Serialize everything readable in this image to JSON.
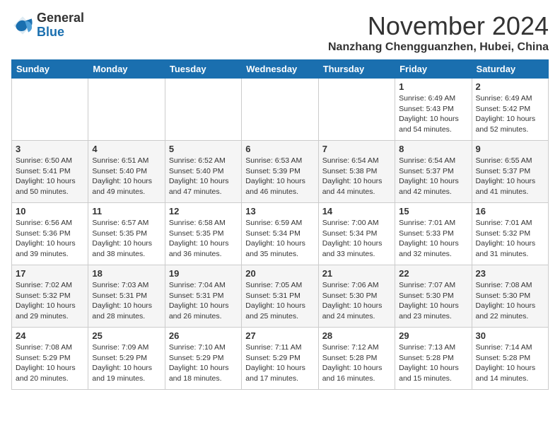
{
  "header": {
    "logo_general": "General",
    "logo_blue": "Blue",
    "title": "November 2024",
    "location": "Nanzhang Chengguanzhen, Hubei, China"
  },
  "weekdays": [
    "Sunday",
    "Monday",
    "Tuesday",
    "Wednesday",
    "Thursday",
    "Friday",
    "Saturday"
  ],
  "weeks": [
    [
      {
        "day": "",
        "info": ""
      },
      {
        "day": "",
        "info": ""
      },
      {
        "day": "",
        "info": ""
      },
      {
        "day": "",
        "info": ""
      },
      {
        "day": "",
        "info": ""
      },
      {
        "day": "1",
        "info": "Sunrise: 6:49 AM\nSunset: 5:43 PM\nDaylight: 10 hours and 54 minutes."
      },
      {
        "day": "2",
        "info": "Sunrise: 6:49 AM\nSunset: 5:42 PM\nDaylight: 10 hours and 52 minutes."
      }
    ],
    [
      {
        "day": "3",
        "info": "Sunrise: 6:50 AM\nSunset: 5:41 PM\nDaylight: 10 hours and 50 minutes."
      },
      {
        "day": "4",
        "info": "Sunrise: 6:51 AM\nSunset: 5:40 PM\nDaylight: 10 hours and 49 minutes."
      },
      {
        "day": "5",
        "info": "Sunrise: 6:52 AM\nSunset: 5:40 PM\nDaylight: 10 hours and 47 minutes."
      },
      {
        "day": "6",
        "info": "Sunrise: 6:53 AM\nSunset: 5:39 PM\nDaylight: 10 hours and 46 minutes."
      },
      {
        "day": "7",
        "info": "Sunrise: 6:54 AM\nSunset: 5:38 PM\nDaylight: 10 hours and 44 minutes."
      },
      {
        "day": "8",
        "info": "Sunrise: 6:54 AM\nSunset: 5:37 PM\nDaylight: 10 hours and 42 minutes."
      },
      {
        "day": "9",
        "info": "Sunrise: 6:55 AM\nSunset: 5:37 PM\nDaylight: 10 hours and 41 minutes."
      }
    ],
    [
      {
        "day": "10",
        "info": "Sunrise: 6:56 AM\nSunset: 5:36 PM\nDaylight: 10 hours and 39 minutes."
      },
      {
        "day": "11",
        "info": "Sunrise: 6:57 AM\nSunset: 5:35 PM\nDaylight: 10 hours and 38 minutes."
      },
      {
        "day": "12",
        "info": "Sunrise: 6:58 AM\nSunset: 5:35 PM\nDaylight: 10 hours and 36 minutes."
      },
      {
        "day": "13",
        "info": "Sunrise: 6:59 AM\nSunset: 5:34 PM\nDaylight: 10 hours and 35 minutes."
      },
      {
        "day": "14",
        "info": "Sunrise: 7:00 AM\nSunset: 5:34 PM\nDaylight: 10 hours and 33 minutes."
      },
      {
        "day": "15",
        "info": "Sunrise: 7:01 AM\nSunset: 5:33 PM\nDaylight: 10 hours and 32 minutes."
      },
      {
        "day": "16",
        "info": "Sunrise: 7:01 AM\nSunset: 5:32 PM\nDaylight: 10 hours and 31 minutes."
      }
    ],
    [
      {
        "day": "17",
        "info": "Sunrise: 7:02 AM\nSunset: 5:32 PM\nDaylight: 10 hours and 29 minutes."
      },
      {
        "day": "18",
        "info": "Sunrise: 7:03 AM\nSunset: 5:31 PM\nDaylight: 10 hours and 28 minutes."
      },
      {
        "day": "19",
        "info": "Sunrise: 7:04 AM\nSunset: 5:31 PM\nDaylight: 10 hours and 26 minutes."
      },
      {
        "day": "20",
        "info": "Sunrise: 7:05 AM\nSunset: 5:31 PM\nDaylight: 10 hours and 25 minutes."
      },
      {
        "day": "21",
        "info": "Sunrise: 7:06 AM\nSunset: 5:30 PM\nDaylight: 10 hours and 24 minutes."
      },
      {
        "day": "22",
        "info": "Sunrise: 7:07 AM\nSunset: 5:30 PM\nDaylight: 10 hours and 23 minutes."
      },
      {
        "day": "23",
        "info": "Sunrise: 7:08 AM\nSunset: 5:30 PM\nDaylight: 10 hours and 22 minutes."
      }
    ],
    [
      {
        "day": "24",
        "info": "Sunrise: 7:08 AM\nSunset: 5:29 PM\nDaylight: 10 hours and 20 minutes."
      },
      {
        "day": "25",
        "info": "Sunrise: 7:09 AM\nSunset: 5:29 PM\nDaylight: 10 hours and 19 minutes."
      },
      {
        "day": "26",
        "info": "Sunrise: 7:10 AM\nSunset: 5:29 PM\nDaylight: 10 hours and 18 minutes."
      },
      {
        "day": "27",
        "info": "Sunrise: 7:11 AM\nSunset: 5:29 PM\nDaylight: 10 hours and 17 minutes."
      },
      {
        "day": "28",
        "info": "Sunrise: 7:12 AM\nSunset: 5:28 PM\nDaylight: 10 hours and 16 minutes."
      },
      {
        "day": "29",
        "info": "Sunrise: 7:13 AM\nSunset: 5:28 PM\nDaylight: 10 hours and 15 minutes."
      },
      {
        "day": "30",
        "info": "Sunrise: 7:14 AM\nSunset: 5:28 PM\nDaylight: 10 hours and 14 minutes."
      }
    ]
  ]
}
